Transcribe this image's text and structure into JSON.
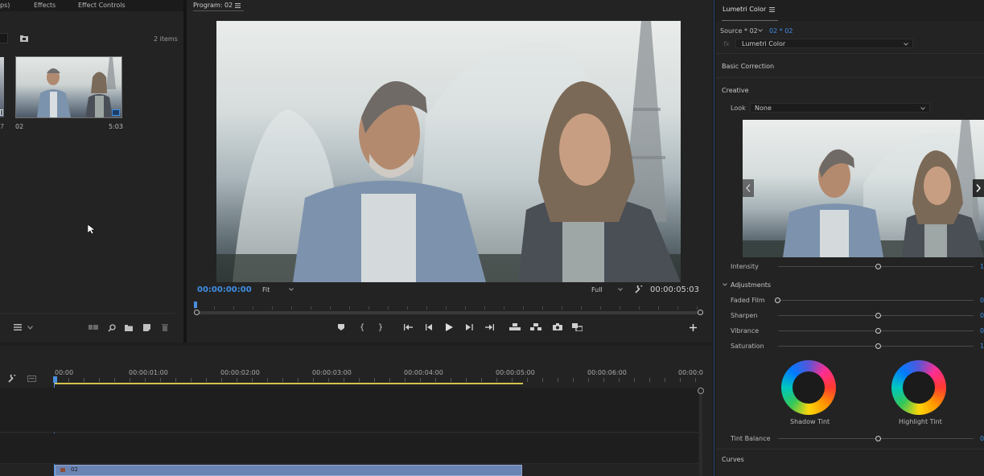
{
  "project_panel": {
    "tabs": [
      "ps)",
      "Effects",
      "Effect Controls"
    ],
    "item_count": "2 items",
    "clip_name": "02",
    "clip_duration": "5:03",
    "partial_label": "7"
  },
  "program_monitor": {
    "title": "Program: 02",
    "timecode_current": "00:00:00:00",
    "zoom_select": "Fit",
    "quality_select": "Full",
    "timecode_duration": "00:00:05:03"
  },
  "timeline": {
    "ruler_labels": [
      "00:00",
      "00:00:01:00",
      "00:00:02:00",
      "00:00:03:00",
      "00:00:04:00",
      "00:00:05:00",
      "00:00:06:00",
      "00:00:0"
    ],
    "clip_label": "02"
  },
  "lumetri": {
    "title": "Lumetri Color",
    "source_label": "Source * 02",
    "sequence_label": "02 * 02",
    "fx_label": "fx",
    "effect_select": "Lumetri Color",
    "basic_correction": "Basic Correction",
    "creative": "Creative",
    "look_label": "Look",
    "look_value": "None",
    "intensity_label": "Intensity",
    "intensity_value": "1",
    "adjustments_label": "Adjustments",
    "faded_film_label": "Faded Film",
    "faded_film_value": "0",
    "sharpen_label": "Sharpen",
    "sharpen_value": "0",
    "vibrance_label": "Vibrance",
    "vibrance_value": "0",
    "saturation_label": "Saturation",
    "saturation_value": "1",
    "shadow_tint_label": "Shadow Tint",
    "highlight_tint_label": "Highlight Tint",
    "tint_balance_label": "Tint Balance",
    "tint_balance_value": "0",
    "curves_label": "Curves"
  },
  "colors": {
    "accent_blue": "#3f8ee6",
    "playhead_blue": "#4a8fe0",
    "work_area_yellow": "#d4c24a",
    "timeline_clip": "#6a84b4"
  }
}
